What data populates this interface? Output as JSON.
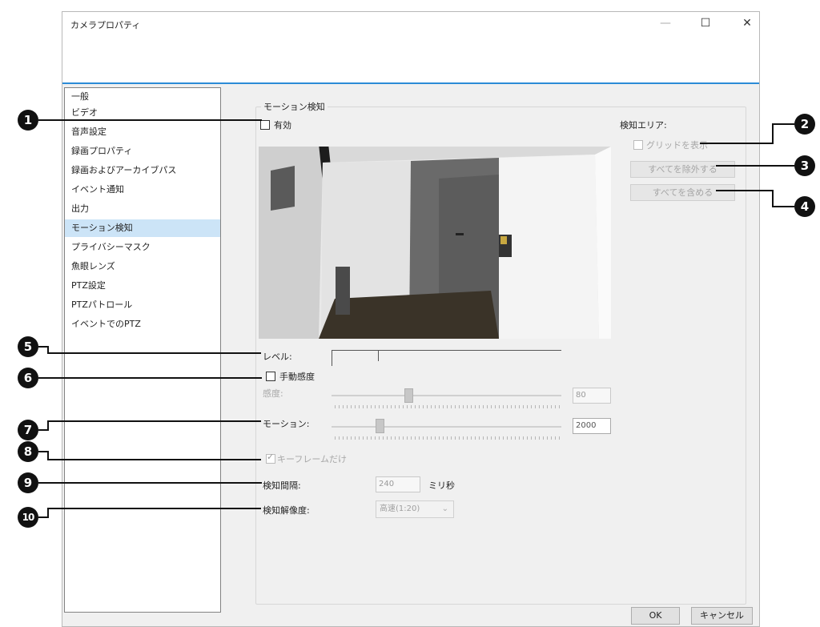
{
  "window": {
    "title": "カメラプロパティ",
    "minimize": "—",
    "maximize": "☐",
    "close": "✕"
  },
  "sidebar": {
    "selected_index": 8,
    "items": [
      {
        "label": "一般"
      },
      {
        "label": "ビデオ"
      },
      {
        "label": "音声設定"
      },
      {
        "label": "録画プロパティ"
      },
      {
        "label": "録画およびアーカイブパス"
      },
      {
        "label": "イベント通知"
      },
      {
        "label": "出力"
      },
      {
        "label": "モーション検知"
      },
      {
        "label": "プライバシーマスク"
      },
      {
        "label": "魚眼レンズ"
      },
      {
        "label": "PTZ設定"
      },
      {
        "label": "PTZパトロール"
      },
      {
        "label": "イベントでのPTZ"
      }
    ]
  },
  "motion": {
    "group_title": "モーション検知",
    "enable_label": "有効",
    "enable_checked": false,
    "level_label": "レベル:",
    "manual_sensitivity_label": "手動感度",
    "manual_sensitivity_checked": false,
    "sensitivity_label": "感度:",
    "sensitivity_value": "80",
    "sensitivity_fraction": 0.33,
    "motion_label": "モーション:",
    "motion_value": "2000",
    "motion_fraction": 0.2,
    "keyframe_label": "キーフレームだけ",
    "keyframe_checked": true,
    "interval_label": "検知間隔:",
    "interval_value": "240",
    "interval_unit": "ミリ秒",
    "resolution_label": "検知解像度:",
    "resolution_value": "高速(1:20)"
  },
  "detection_area": {
    "title": "検知エリア:",
    "show_grid_label": "グリッドを表示",
    "exclude_all_label": "すべてを除外する",
    "include_all_label": "すべてを含める"
  },
  "footer": {
    "ok_label": "OK",
    "cancel_label": "キャンセル"
  },
  "callouts": [
    "1",
    "2",
    "3",
    "4",
    "5",
    "6",
    "7",
    "8",
    "9",
    "10"
  ]
}
